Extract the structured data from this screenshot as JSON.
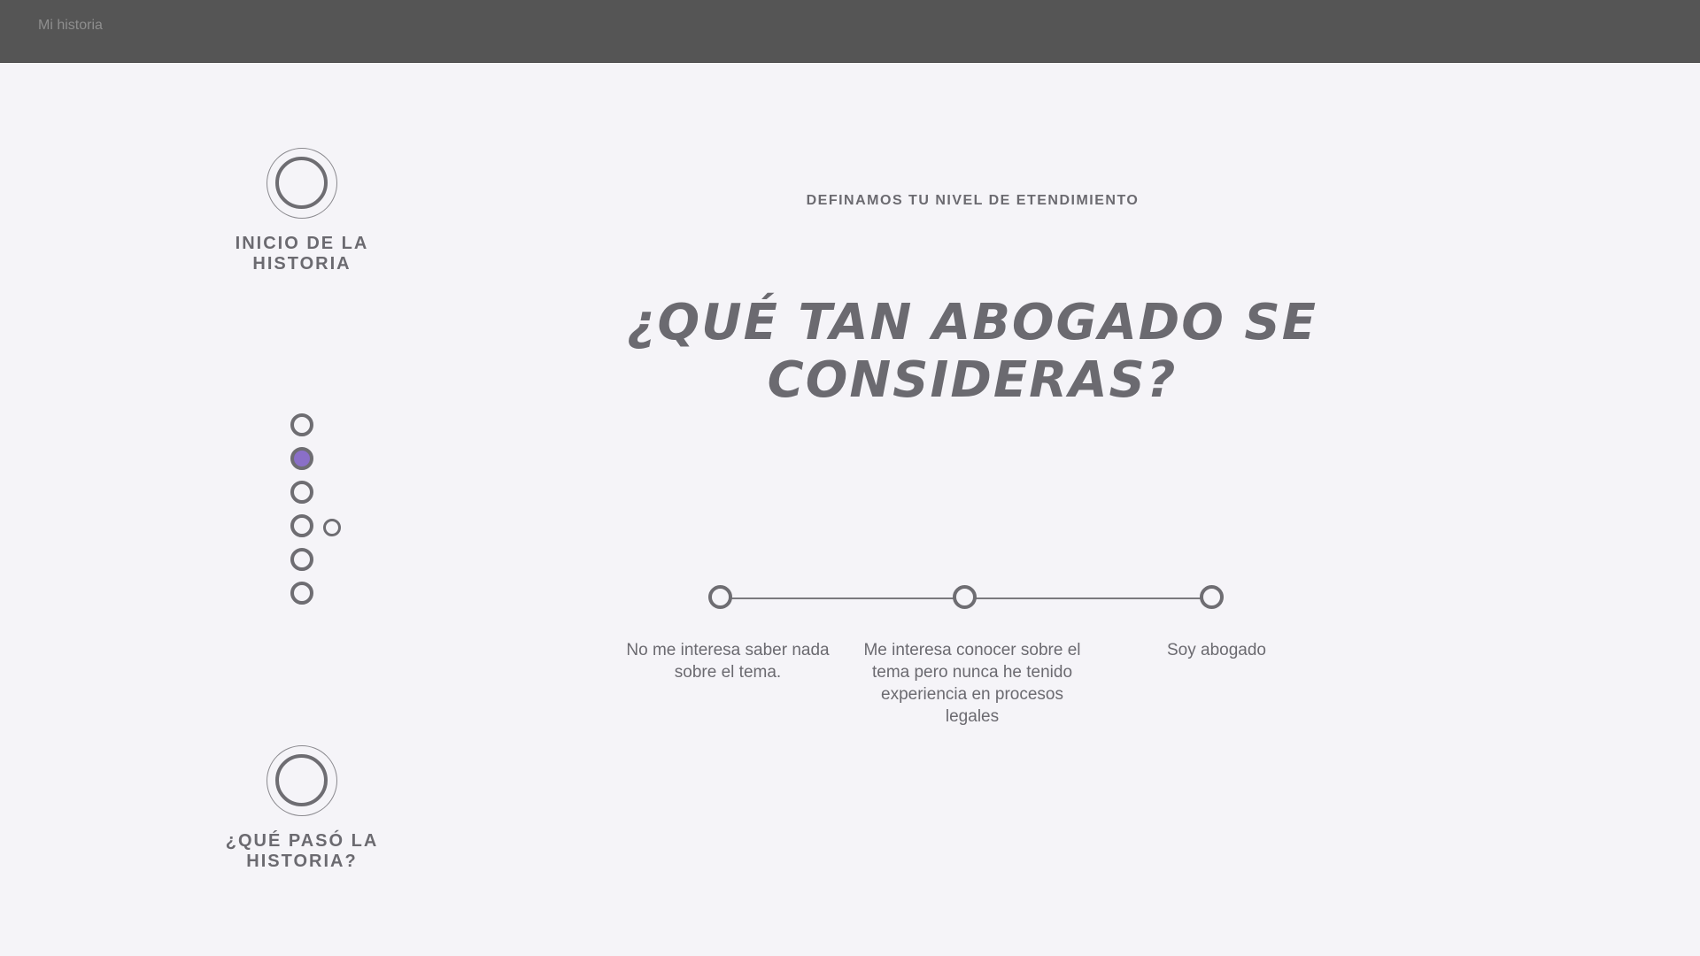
{
  "topbar": {
    "title": "Mi historia"
  },
  "nav": {
    "start_label": "INICIO DE LA HISTORIA",
    "end_label": "¿QUÉ PASÓ LA HISTORIA?",
    "steps_total": 6,
    "active_step": 2
  },
  "main": {
    "kicker": "DEFINAMOS TU NIVEL DE ETENDIMIENTO",
    "headline": "¿Qué tan abogado se consideras?",
    "scale": {
      "options": [
        {
          "label": "No me interesa saber nada sobre el tema."
        },
        {
          "label": "Me interesa conocer sobre el tema pero nunca he tenido experiencia en procesos legales"
        },
        {
          "label": "Soy abogado"
        }
      ]
    }
  },
  "colors": {
    "background": "#f5f4f8",
    "topbar": "#555555",
    "text": "#6b6a70",
    "accent": "#8a6fc8"
  }
}
